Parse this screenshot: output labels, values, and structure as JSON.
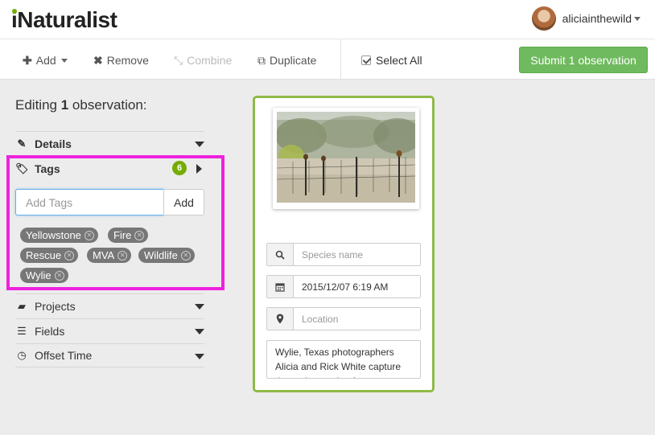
{
  "header": {
    "logo": "iNaturalist",
    "username": "aliciainthewild"
  },
  "toolbar": {
    "add_label": "Add",
    "remove_label": "Remove",
    "combine_label": "Combine",
    "duplicate_label": "Duplicate",
    "select_all_label": "Select All",
    "submit_label": "Submit 1 observation"
  },
  "panel": {
    "editing_prefix": "Editing",
    "editing_count": "1",
    "editing_suffix": "observation:",
    "sections": {
      "details": "Details",
      "tags": "Tags",
      "projects": "Projects",
      "fields": "Fields",
      "offset_time": "Offset Time"
    },
    "tags_count": "6",
    "tag_input_placeholder": "Add Tags",
    "tag_add_button": "Add",
    "tags": [
      "Yellowstone",
      "Fire",
      "Rescue",
      "MVA",
      "Wildlife",
      "Wylie"
    ]
  },
  "observation": {
    "species_placeholder": "Species name",
    "datetime": "2015/12/07 6:19 AM",
    "location_placeholder": "Location",
    "description": "Wylie, Texas photographers Alicia and Rick White capture the early morning fog on a"
  },
  "colors": {
    "accent_green": "#74ac00",
    "submit_green": "#6fba5e",
    "card_border": "#8fba48",
    "highlight_magenta": "#ee22dd"
  }
}
